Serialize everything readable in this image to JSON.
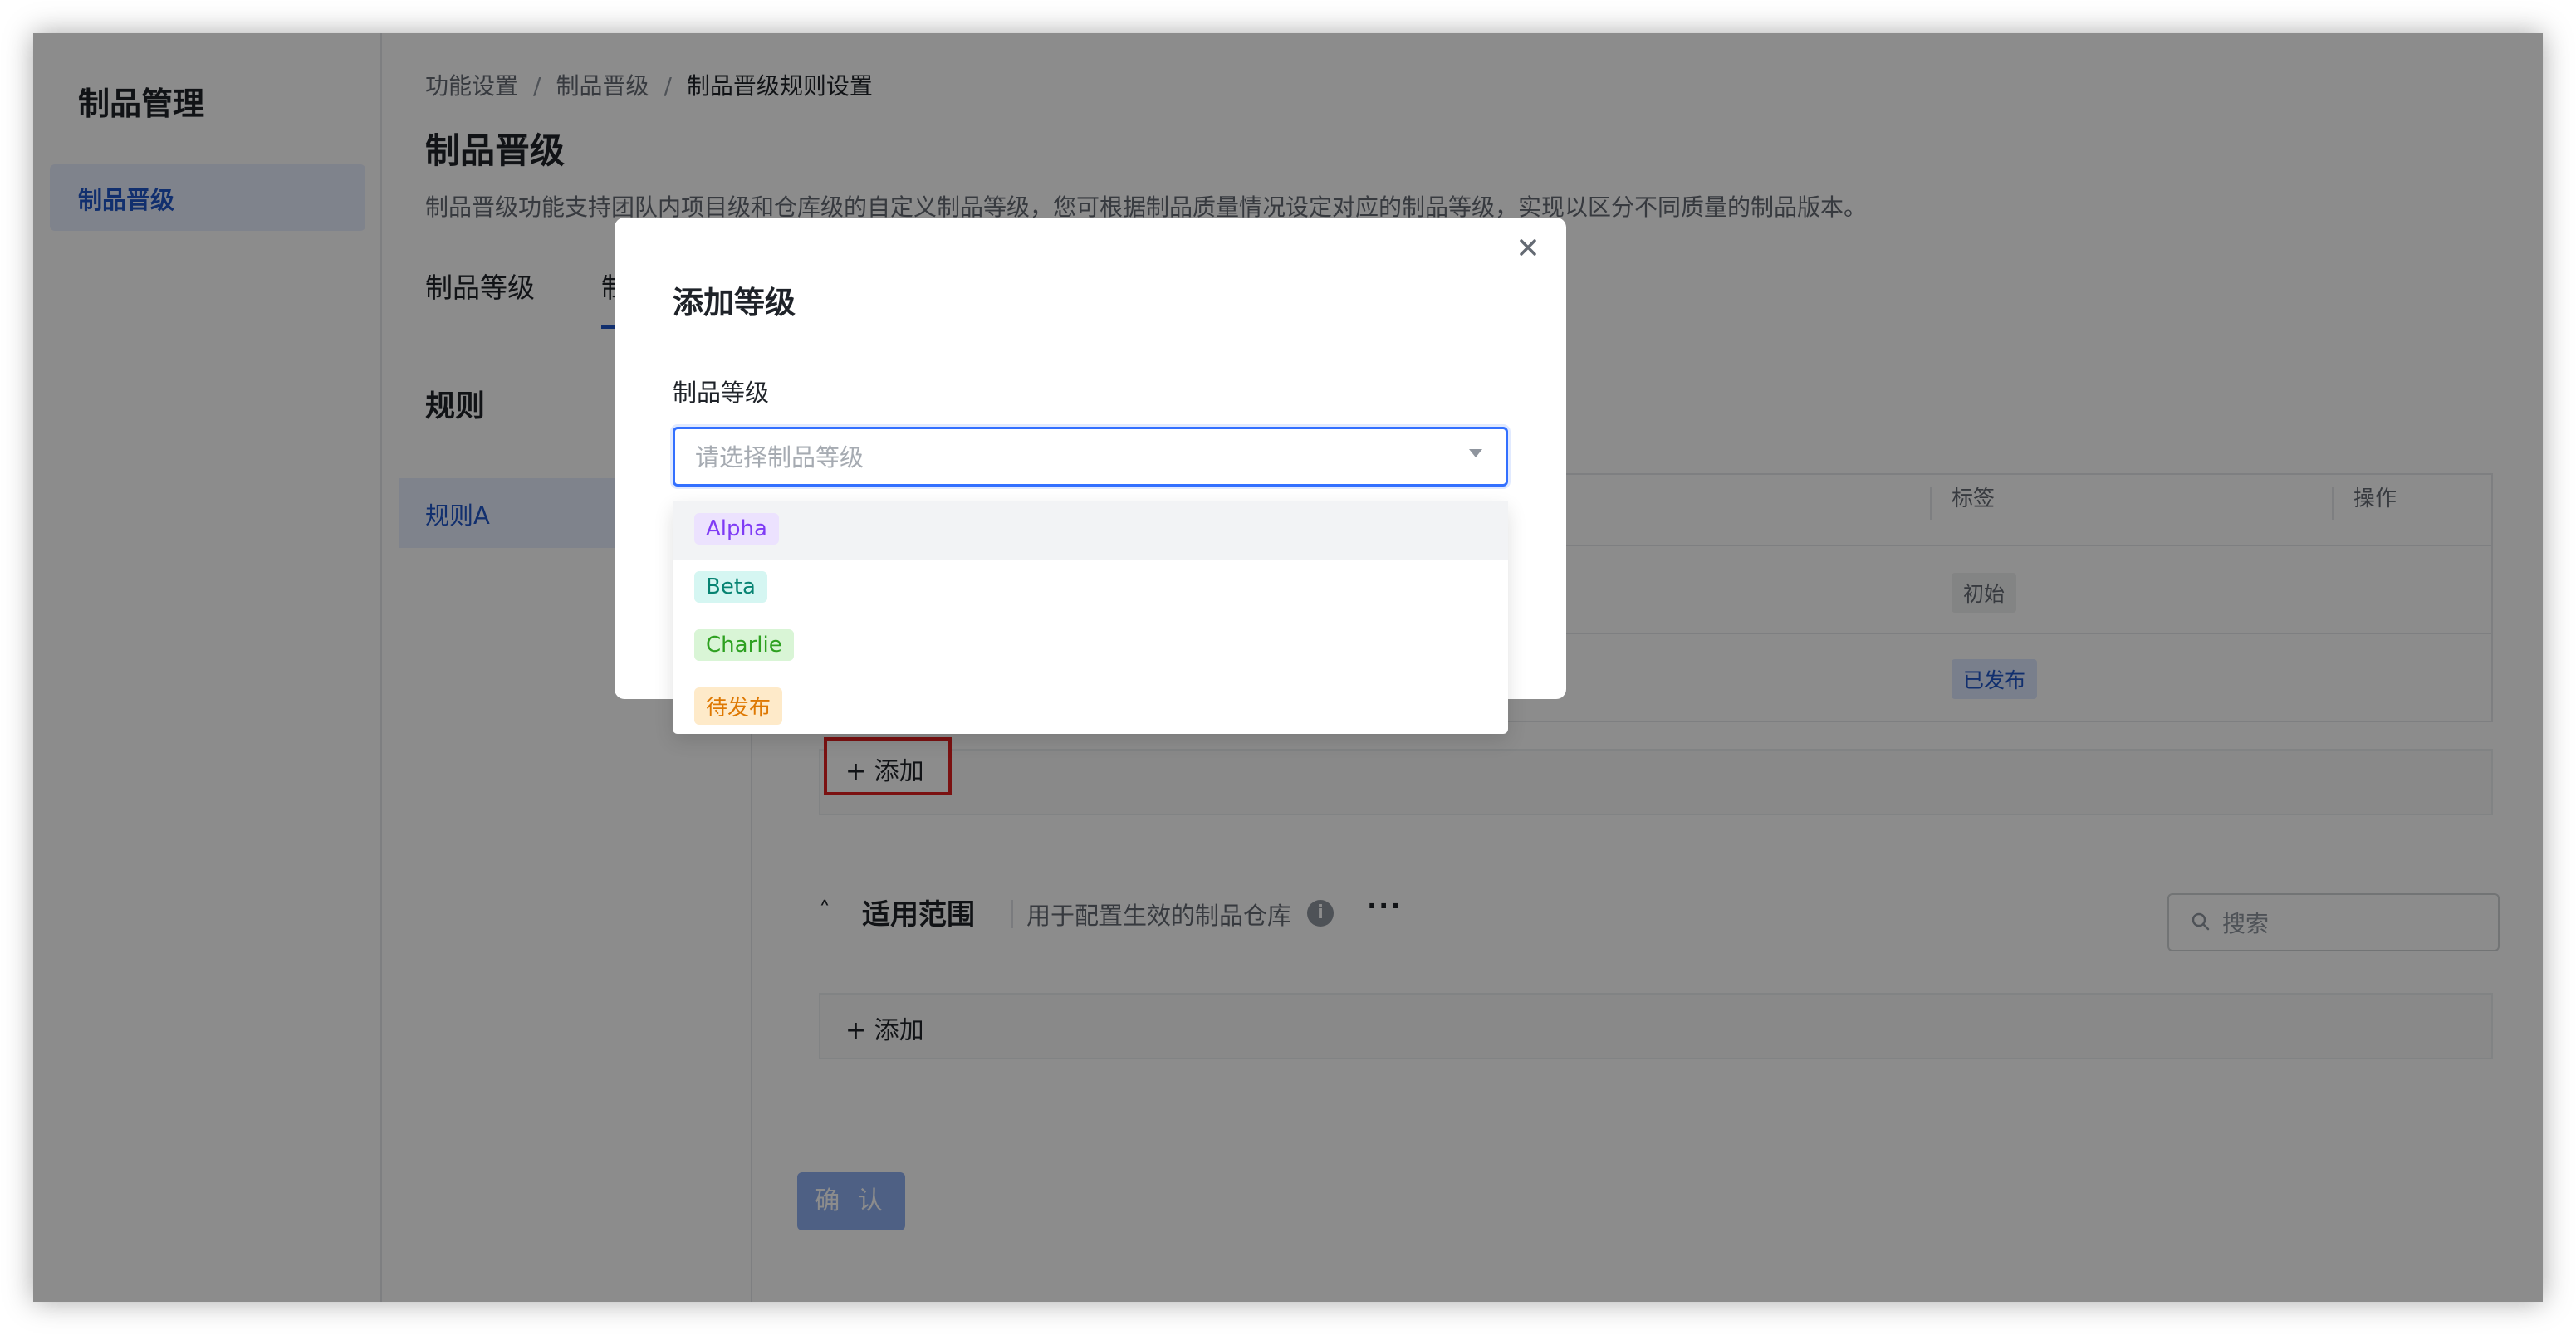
{
  "sidebar": {
    "title": "制品管理",
    "items": [
      {
        "label": "制品晋级"
      }
    ]
  },
  "breadcrumb": {
    "items": [
      "功能设置",
      "制品晋级",
      "制品晋级规则设置"
    ],
    "separator": "/"
  },
  "page": {
    "title": "制品晋级",
    "description": "制品晋级功能支持团队内项目级和仓库级的自定义制品等级，您可根据制品质量情况设定对应的制品等级，实现以区分不同质量的制品版本。"
  },
  "tabs": [
    {
      "label": "制品等级"
    },
    {
      "label": "制"
    }
  ],
  "rules": {
    "heading": "规则",
    "items": [
      {
        "label": "规则A"
      }
    ]
  },
  "table": {
    "headers": [
      "标签",
      "操作"
    ],
    "rows": [
      {
        "tag": "初始"
      },
      {
        "tag": "已发布"
      }
    ],
    "add_label": "+ 添加"
  },
  "scope": {
    "caret": "˄",
    "title": "适用范围",
    "description": "用于配置生效的制品仓库",
    "info_icon": "i",
    "more_icon": "···",
    "search_placeholder": "搜索",
    "add_label": "+ 添加"
  },
  "confirm_label": "确 认",
  "modal": {
    "title": "添加等级",
    "field_label": "制品等级",
    "select_placeholder": "请选择制品等级",
    "options": [
      {
        "label": "Alpha",
        "color": "#7f3bf5"
      },
      {
        "label": "Beta",
        "color": "#078372"
      },
      {
        "label": "Charlie",
        "color": "#2ea121"
      },
      {
        "label": "待发布",
        "color": "#de7802"
      }
    ]
  },
  "colors": {
    "accent": "#3370ff",
    "highlight_border": "#e02020"
  }
}
